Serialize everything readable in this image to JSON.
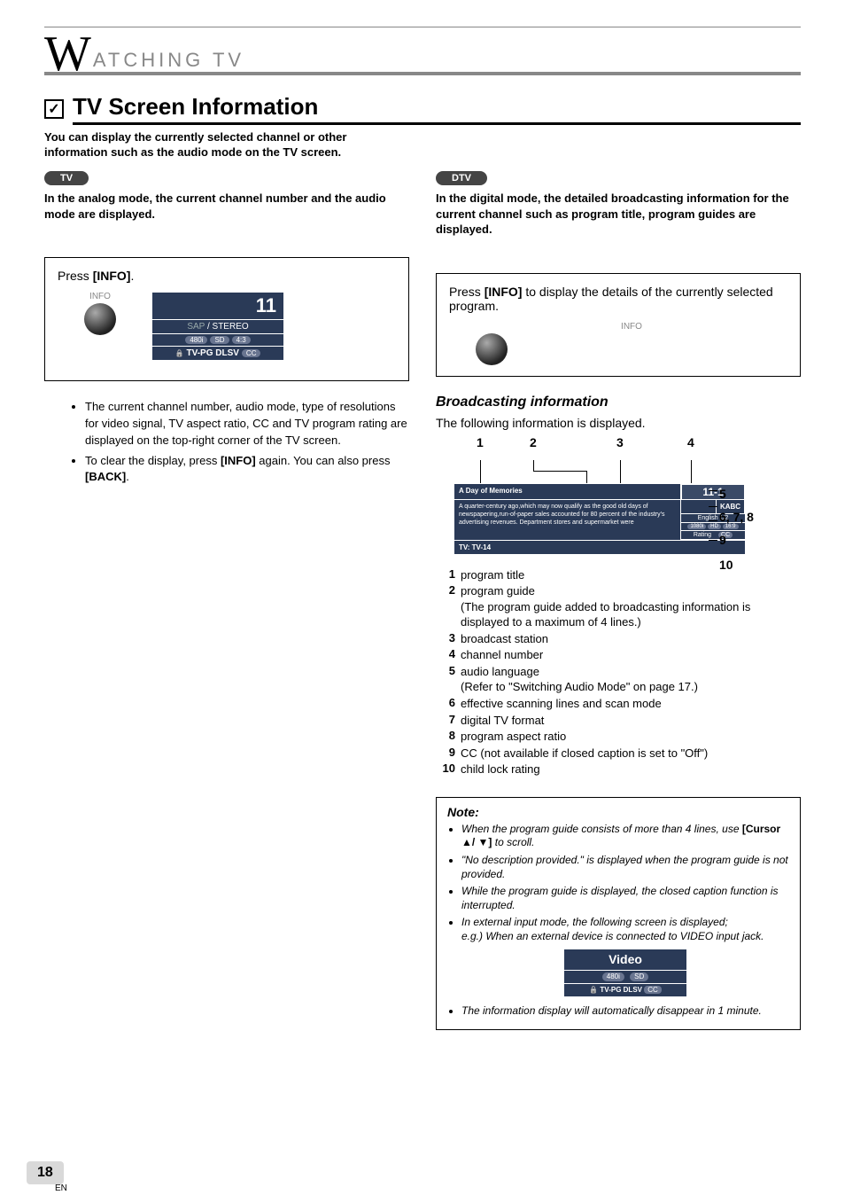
{
  "header": {
    "bigLetter": "W",
    "rest": "ATCHING  TV"
  },
  "section": {
    "checkmark": "✓",
    "title": "TV Screen Information",
    "intro": "You can display the currently selected channel or other information such as the audio mode on the TV screen."
  },
  "left": {
    "pill": "TV",
    "modeDesc": "In the analog mode, the current channel number and the audio mode are displayed.",
    "pressLinePrefix": "Press ",
    "pressKey": "[INFO]",
    "pressLineSuffix": ".",
    "infoLabel": "INFO",
    "osd": {
      "channel": "11",
      "audioLine": "SAP / STEREO",
      "badges": [
        "480i",
        "SD",
        "4:3"
      ],
      "rating": "TV-PG DLSV",
      "cc": "CC"
    },
    "bullets": [
      "The current channel number, audio mode, type of resolutions for video signal, TV aspect ratio, CC and TV program rating are displayed on the top-right corner of the TV screen.",
      "To clear the display, press [INFO] again. You can also press [BACK]."
    ]
  },
  "right": {
    "pill": "DTV",
    "modeDesc": "In the digital mode, the detailed broadcasting information for the current channel such as program title, program guides are displayed.",
    "pressText": "Press [INFO] to display the details of the currently selected program.",
    "infoLabel": "INFO",
    "subHeading": "Broadcasting information",
    "followLine": "The following information is displayed.",
    "callTop": {
      "c1": "1",
      "c2": "2",
      "c3": "3",
      "c4": "4"
    },
    "callRight": {
      "r5": "5",
      "r678": "6, 7, 8",
      "r9": "9",
      "r10": "10"
    },
    "osd": {
      "title": "A Day of Memories",
      "station": "KABC",
      "channel": "11-1",
      "guide": "A quarter-century ago,which may now qualify as the good old days of newspapering,run-of-paper sales accounted for 80 percent of the industry's advertising revenues. Department stores and supermarket were",
      "audio": "English 1/2",
      "scan": [
        "1080i",
        "HD",
        "16:9"
      ],
      "ratingLabel": "Rating",
      "cc": "CC",
      "tvRating": "TV: TV-14"
    },
    "defs": [
      {
        "n": "1",
        "t": "program title"
      },
      {
        "n": "2",
        "t": "program guide\n(The program guide added to broadcasting information is displayed to a maximum of 4 lines.)"
      },
      {
        "n": "3",
        "t": "broadcast station"
      },
      {
        "n": "4",
        "t": "channel number"
      },
      {
        "n": "5",
        "t": "audio language\n(Refer to \"Switching Audio Mode\" on page 17.)"
      },
      {
        "n": "6",
        "t": "effective scanning lines and scan mode"
      },
      {
        "n": "7",
        "t": "digital TV format"
      },
      {
        "n": "8",
        "t": "program aspect ratio"
      },
      {
        "n": "9",
        "t": "CC (not available if closed caption is set to \"Off\")"
      },
      {
        "n": "10",
        "t": "child lock rating"
      }
    ],
    "note": {
      "heading": "Note:",
      "items": [
        "When the program guide consists of more than 4 lines, use [Cursor ▲/ ▼] to scroll.",
        "\"No description provided.\" is displayed when the program guide is not provided.",
        "While the program guide is displayed, the closed caption function is interrupted.",
        "In external input mode, the following screen is displayed; e.g.) When an external device is connected to VIDEO input jack.",
        "The information display will automatically disappear in 1 minute."
      ],
      "extOsd": {
        "title": "Video",
        "badges": [
          "480i",
          "SD"
        ],
        "rating": "TV-PG DLSV",
        "cc": "CC"
      }
    }
  },
  "pageNumber": "18",
  "pageLang": "EN"
}
